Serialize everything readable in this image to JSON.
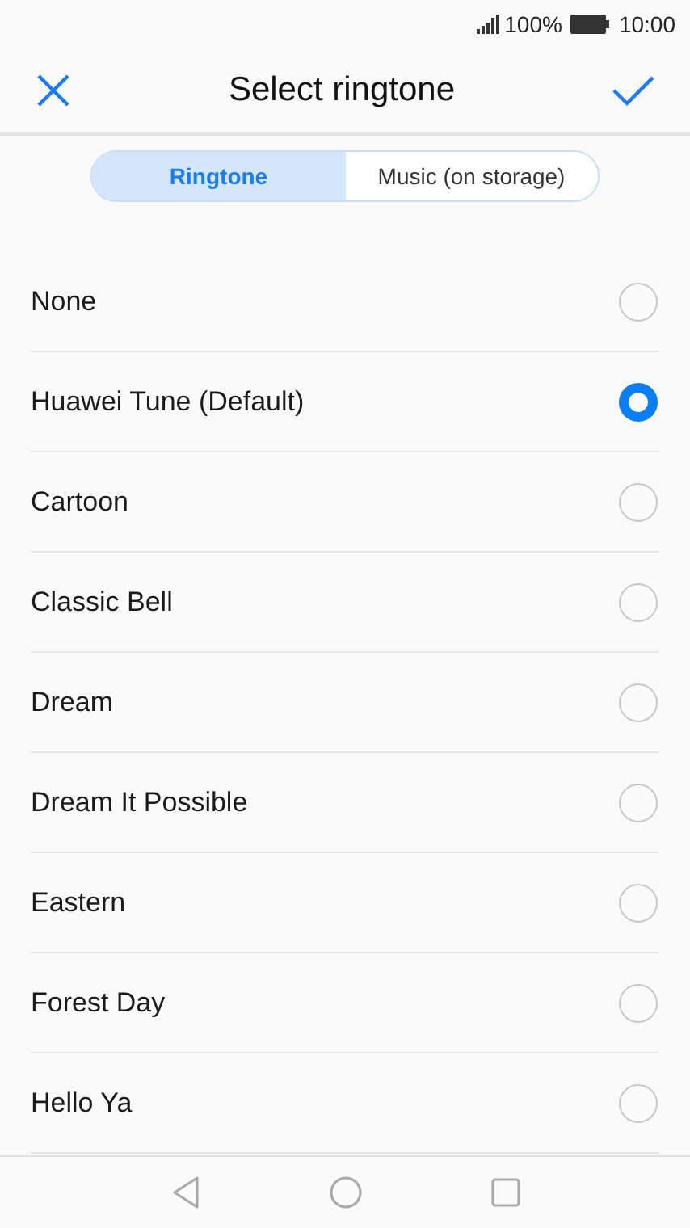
{
  "status_bar": {
    "battery_text": "100%",
    "time": "10:00"
  },
  "header": {
    "title": "Select ringtone"
  },
  "tabs": [
    {
      "label": "Ringtone",
      "selected": true
    },
    {
      "label": "Music (on storage)",
      "selected": false
    }
  ],
  "ringtones": [
    {
      "name": "None",
      "selected": false
    },
    {
      "name": "Huawei Tune (Default)",
      "selected": true
    },
    {
      "name": "Cartoon",
      "selected": false
    },
    {
      "name": "Classic Bell",
      "selected": false
    },
    {
      "name": "Dream",
      "selected": false
    },
    {
      "name": "Dream It Possible",
      "selected": false
    },
    {
      "name": "Eastern",
      "selected": false
    },
    {
      "name": "Forest Day",
      "selected": false
    },
    {
      "name": "Hello Ya",
      "selected": false
    }
  ]
}
